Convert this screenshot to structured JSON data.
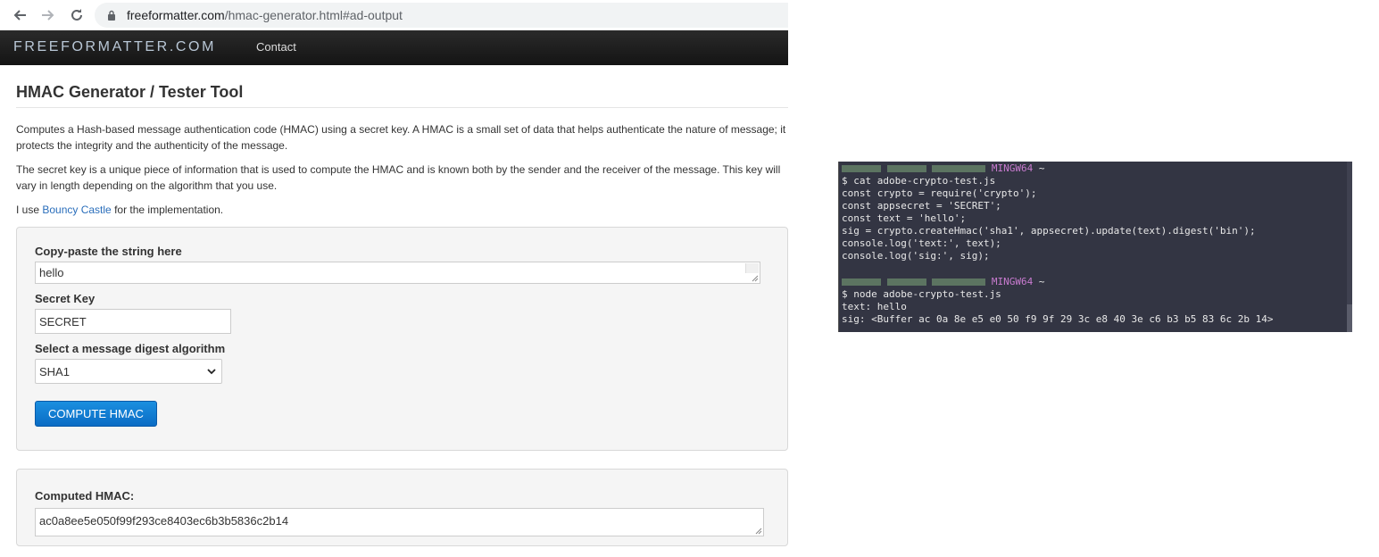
{
  "browser": {
    "url_domain": "freeformatter.com",
    "url_path": "/hmac-generator.html#ad-output"
  },
  "site": {
    "brand": "FREEFORMATTER.COM",
    "nav_contact": "Contact"
  },
  "page": {
    "title": "HMAC Generator / Tester Tool",
    "para1": "Computes a Hash-based message authentication code (HMAC) using a secret key. A HMAC is a small set of data that helps authenticate the nature of message; it protects the integrity and the authenticity of the message.",
    "para2": "The secret key is a unique piece of information that is used to compute the HMAC and is known both by the sender and the receiver of the message. This key will vary in length depending on the algorithm that you use.",
    "para3_prefix": "I use ",
    "para3_link": "Bouncy Castle",
    "para3_suffix": " for the implementation."
  },
  "form": {
    "string_label": "Copy-paste the string here",
    "string_value": "hello",
    "key_label": "Secret Key",
    "key_value": "SECRET",
    "algo_label": "Select a message digest algorithm",
    "algo_value": "SHA1",
    "compute_button": "COMPUTE HMAC"
  },
  "output": {
    "label": "Computed HMAC:",
    "value": "ac0a8ee5e050f99f293ce8403ec6b3b5836c2b14"
  },
  "terminal": {
    "prompt_env": "MINGW64",
    "prompt_dir": " ~",
    "lines1": [
      "$ cat adobe-crypto-test.js",
      "const crypto = require('crypto');",
      "const appsecret = 'SECRET';",
      "const text = 'hello';",
      "sig = crypto.createHmac('sha1', appsecret).update(text).digest('bin');",
      "console.log('text:', text);",
      "console.log('sig:', sig);"
    ],
    "lines2": [
      "$ node adobe-crypto-test.js",
      "text: hello",
      "sig: <Buffer ac 0a 8e e5 e0 50 f9 9f 29 3c e8 40 3e c6 b3 b5 83 6c 2b 14>"
    ]
  },
  "colors": {
    "accent": "#0a6cc4",
    "navbar": "#1c1c1c",
    "terminal_bg": "#333543",
    "mingw": "#c97bd0"
  }
}
